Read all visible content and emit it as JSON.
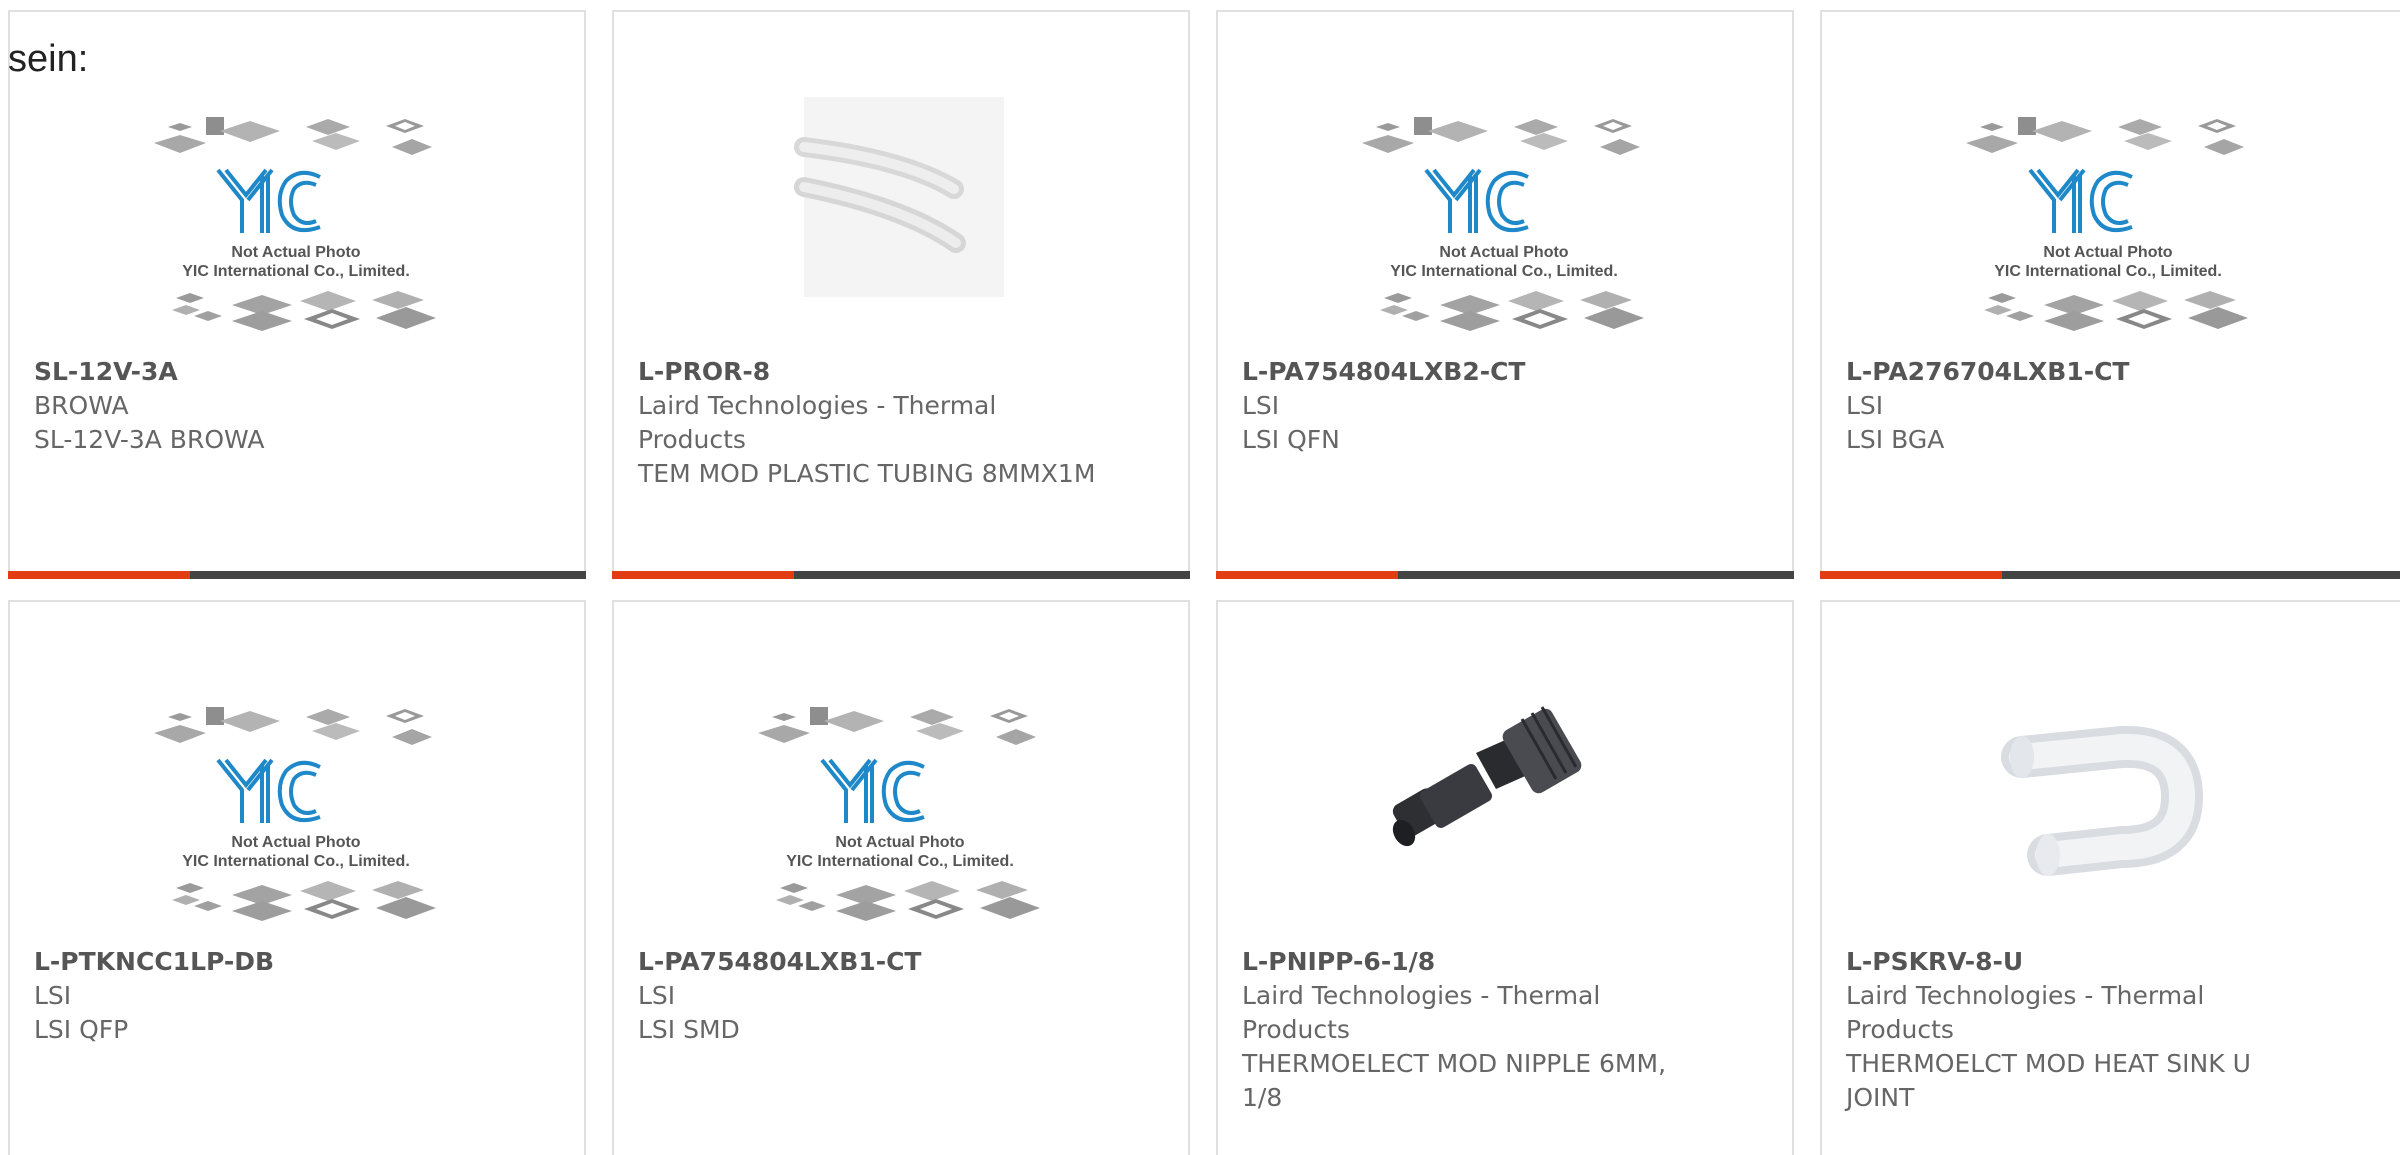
{
  "prefix_text": "sein:",
  "colors": {
    "accent": "#e33b12",
    "bar": "#444444",
    "logo_blue": "#1e88c8"
  },
  "placeholder": {
    "line1": "Not Actual Photo",
    "line2": "YIC International Co., Limited."
  },
  "products": [
    {
      "part_number": "SL-12V-3A",
      "manufacturer": "BROWA",
      "description": "SL-12V-3A BROWA",
      "image": "placeholder-photo"
    },
    {
      "part_number": "L-PROR-8",
      "manufacturer": "Laird Technologies - Thermal Products",
      "description": "TEM MOD PLASTIC TUBING 8MMX1M",
      "image": "plastic-tubing-photo"
    },
    {
      "part_number": "L-PA754804LXB2-CT",
      "manufacturer": "LSI",
      "description": "LSI QFN",
      "image": "placeholder-photo"
    },
    {
      "part_number": "L-PA276704LXB1-CT",
      "manufacturer": "LSI",
      "description": "LSI BGA",
      "image": "placeholder-photo"
    },
    {
      "part_number": "L-PTKNCC1LP-DB",
      "manufacturer": "LSI",
      "description": "LSI QFP",
      "image": "placeholder-photo"
    },
    {
      "part_number": "L-PA754804LXB1-CT",
      "manufacturer": "LSI",
      "description": "LSI SMD",
      "image": "placeholder-photo"
    },
    {
      "part_number": "L-PNIPP-6-1/8",
      "manufacturer": "Laird Technologies - Thermal Products",
      "description": "THERMOELECT MOD NIPPLE 6MM, 1/8",
      "image": "nipple-fitting-photo"
    },
    {
      "part_number": "L-PSKRV-8-U",
      "manufacturer": "Laird Technologies - Thermal Products",
      "description": "THERMOELCT MOD HEAT SINK U JOINT",
      "image": "u-joint-tube-photo"
    }
  ]
}
